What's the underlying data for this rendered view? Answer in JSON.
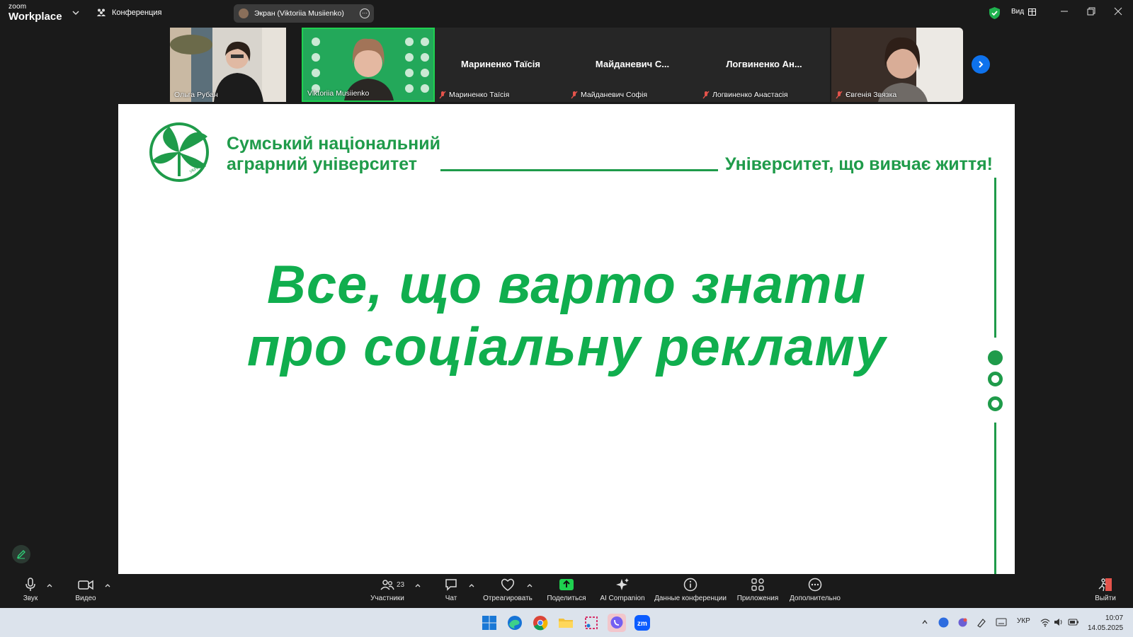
{
  "app": {
    "logo_top": "zoom",
    "logo_bottom": "Workplace"
  },
  "topbar": {
    "meeting_label": "Конференция",
    "share_pill": "Экран (Viktoriia Musiienko)",
    "view_label": "Вид"
  },
  "participants": [
    {
      "name": "Ольга Рубан",
      "muted": false,
      "video": true
    },
    {
      "name": "Viktoriia Musiienko",
      "muted": false,
      "video": true,
      "active": true
    },
    {
      "name": "Мариненко Таїсія",
      "display": "Мариненко  Таїсія",
      "muted": true,
      "video": false
    },
    {
      "name": "Майданевич Софія",
      "display": "Майданевич  С...",
      "muted": true,
      "video": false
    },
    {
      "name": "Логвиненко Анастасія",
      "display": "Логвиненко  Ан...",
      "muted": true,
      "video": false
    },
    {
      "name": "Євгенія Звязка",
      "muted": true,
      "video": true
    }
  ],
  "slide": {
    "university_line1": "Сумський національний",
    "university_line2": "аграрний університет",
    "logo_text": "УКРАЇНА",
    "slogan": "Університет, що вивчає життя!",
    "headline_line1": "Все, що варто знати",
    "headline_line2": "про соціальну рекламу",
    "colors": {
      "brand_green": "#1f9b4a",
      "headline_green": "#10ae4e"
    }
  },
  "toolbar": {
    "audio": "Звук",
    "video": "Видео",
    "participants": "Участники",
    "participants_count": "23",
    "chat": "Чат",
    "react": "Отреагировать",
    "share": "Поделиться",
    "ai": "AI Companion",
    "info": "Данные конференции",
    "apps": "Приложения",
    "more": "Дополнительно",
    "leave": "Выйти"
  },
  "taskbar": {
    "language": "УКР",
    "time": "10:07",
    "date": "14.05.2025"
  }
}
